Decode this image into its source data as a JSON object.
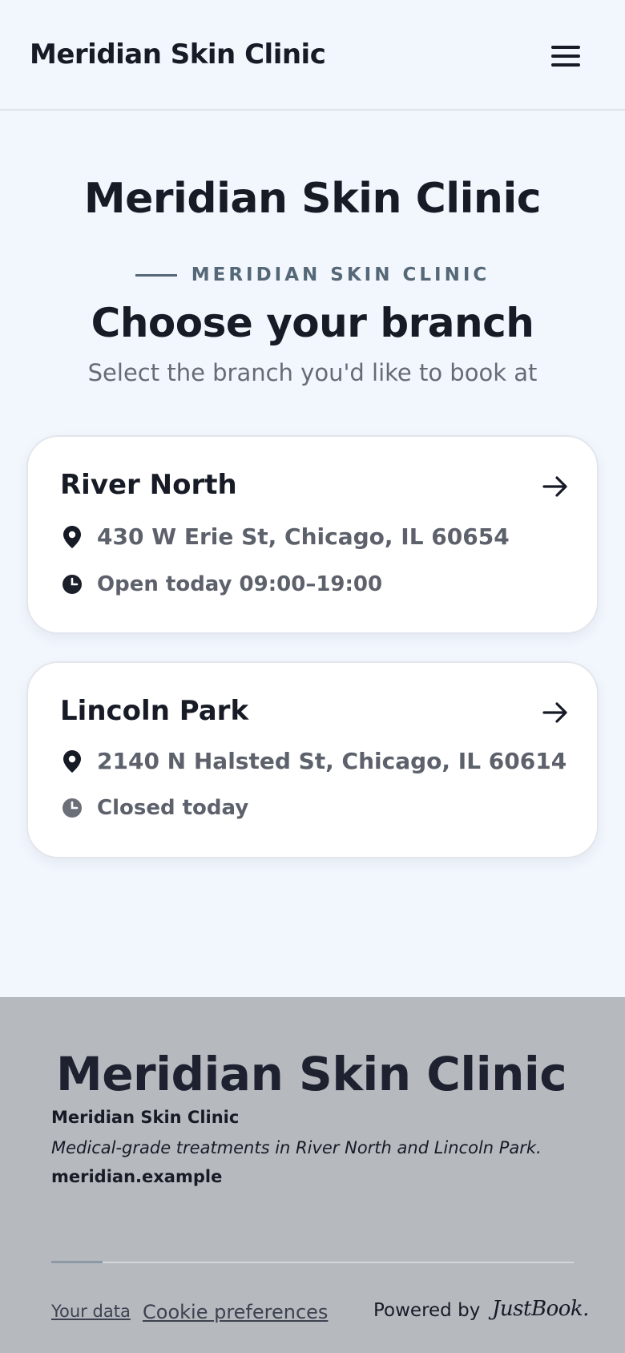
{
  "header": {
    "brand": "Meridian Skin Clinic",
    "menu_icon": "hamburger-menu-icon"
  },
  "main": {
    "title": "Meridian Skin Clinic",
    "eyebrow": "MERIDIAN SKIN CLINIC",
    "heading": "Choose your branch",
    "subtitle": "Select the branch you'd like to book at"
  },
  "branches": [
    {
      "name": "River North",
      "address": "430 W Erie St, Chicago, IL 60654",
      "hours": "Open today 09:00–19:00",
      "clock_color": "#1b1f2a"
    },
    {
      "name": "Lincoln Park",
      "address": "2140 N Halsted St, Chicago, IL 60614",
      "hours": "Closed today",
      "clock_color": "#6b6f78"
    }
  ],
  "footer": {
    "big_title": "Meridian Skin Clinic",
    "name": "Meridian Skin Clinic",
    "tagline": "Medical-grade treatments in River North and Lincoln Park.",
    "website": "meridian.example",
    "links": {
      "your_data": "Your data",
      "cookie_preferences": "Cookie preferences"
    },
    "powered_by": "Powered by",
    "powered_logo": "JustBook."
  },
  "colors": {
    "background": "#f2f6fd",
    "text": "#171b26",
    "muted": "#5c616b",
    "eyebrow": "#556877",
    "footer_bg": "#b6b9be"
  }
}
